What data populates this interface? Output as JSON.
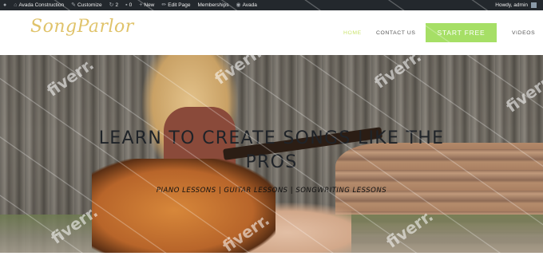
{
  "admin_bar": {
    "site_name": "Avada Construction",
    "customize": "Customize",
    "updates_count": "2",
    "comments_count": "0",
    "new_label": "New",
    "edit_page": "Edit Page",
    "memberships": "Memberships",
    "theme": "Avada",
    "howdy": "Howdy, admin",
    "icons": [
      "wordpress-icon",
      "home-icon",
      "brush-icon",
      "updates-icon",
      "comment-icon",
      "plus-icon",
      "pencil-icon",
      "avada-icon"
    ]
  },
  "header": {
    "logo": "SongParlor",
    "nav": {
      "home": "HOME",
      "contact": "CONTACT US",
      "start": "START FREE",
      "videos": "VIDEOS"
    }
  },
  "hero": {
    "title": "LEARN TO CREATE SONGS LIKE THE PROS",
    "subtitle": "PIANO LESSONS | GUITAR LESSONS | SONGWRITING LESSONS"
  },
  "watermark": "fiverr.",
  "colors": {
    "admin_bar": "#23282d",
    "logo": "#e0c36a",
    "nav_active": "#c9e36a",
    "cta": "#a6df66",
    "title": "#1f2328"
  }
}
